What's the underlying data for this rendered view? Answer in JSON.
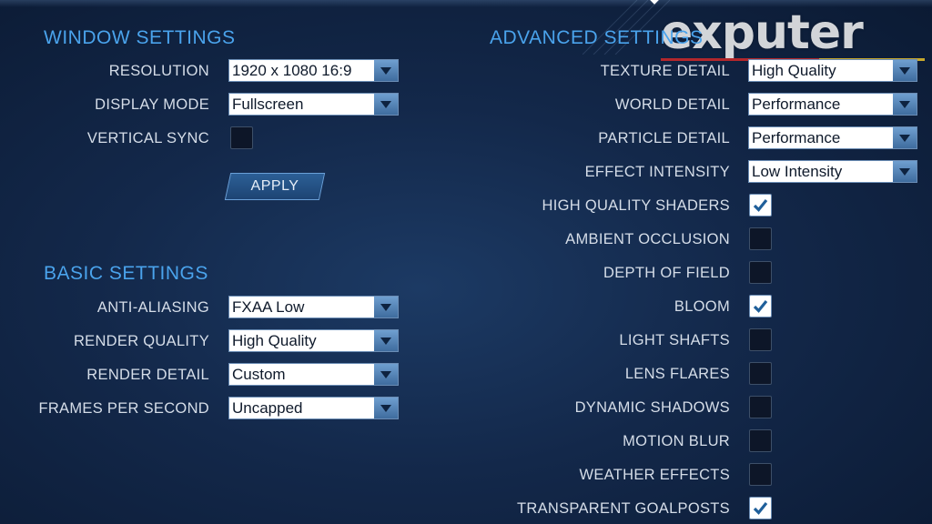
{
  "window_settings": {
    "title": "WINDOW SETTINGS",
    "rows": [
      {
        "label": "RESOLUTION",
        "type": "dropdown",
        "value": "1920 x 1080 16:9"
      },
      {
        "label": "DISPLAY MODE",
        "type": "dropdown",
        "value": "Fullscreen"
      },
      {
        "label": "VERTICAL SYNC",
        "type": "checkbox",
        "checked": false
      }
    ],
    "apply_label": "APPLY"
  },
  "basic_settings": {
    "title": "BASIC SETTINGS",
    "rows": [
      {
        "label": "ANTI-ALIASING",
        "type": "dropdown",
        "value": "FXAA Low"
      },
      {
        "label": "RENDER QUALITY",
        "type": "dropdown",
        "value": "High Quality"
      },
      {
        "label": "RENDER DETAIL",
        "type": "dropdown",
        "value": "Custom"
      },
      {
        "label": "FRAMES PER SECOND",
        "type": "dropdown",
        "value": "Uncapped"
      }
    ]
  },
  "advanced_settings": {
    "title": "ADVANCED SETTINGS",
    "rows": [
      {
        "label": "TEXTURE DETAIL",
        "type": "dropdown",
        "value": "High Quality"
      },
      {
        "label": "WORLD DETAIL",
        "type": "dropdown",
        "value": "Performance"
      },
      {
        "label": "PARTICLE DETAIL",
        "type": "dropdown",
        "value": "Performance"
      },
      {
        "label": "EFFECT INTENSITY",
        "type": "dropdown",
        "value": "Low Intensity"
      },
      {
        "label": "HIGH QUALITY SHADERS",
        "type": "checkbox",
        "checked": true
      },
      {
        "label": "AMBIENT OCCLUSION",
        "type": "checkbox",
        "checked": false
      },
      {
        "label": "DEPTH OF FIELD",
        "type": "checkbox",
        "checked": false
      },
      {
        "label": "BLOOM",
        "type": "checkbox",
        "checked": true
      },
      {
        "label": "LIGHT SHAFTS",
        "type": "checkbox",
        "checked": false
      },
      {
        "label": "LENS FLARES",
        "type": "checkbox",
        "checked": false
      },
      {
        "label": "DYNAMIC SHADOWS",
        "type": "checkbox",
        "checked": false
      },
      {
        "label": "MOTION BLUR",
        "type": "checkbox",
        "checked": false
      },
      {
        "label": "WEATHER EFFECTS",
        "type": "checkbox",
        "checked": false
      },
      {
        "label": "TRANSPARENT GOALPOSTS",
        "type": "checkbox",
        "checked": true
      }
    ]
  },
  "watermark": {
    "text": "exputer"
  },
  "colors": {
    "section_title": "#4aa3ec",
    "label": "#d5dde8",
    "dropdown_arrow": "#4f80b3",
    "background": "#13284a"
  }
}
